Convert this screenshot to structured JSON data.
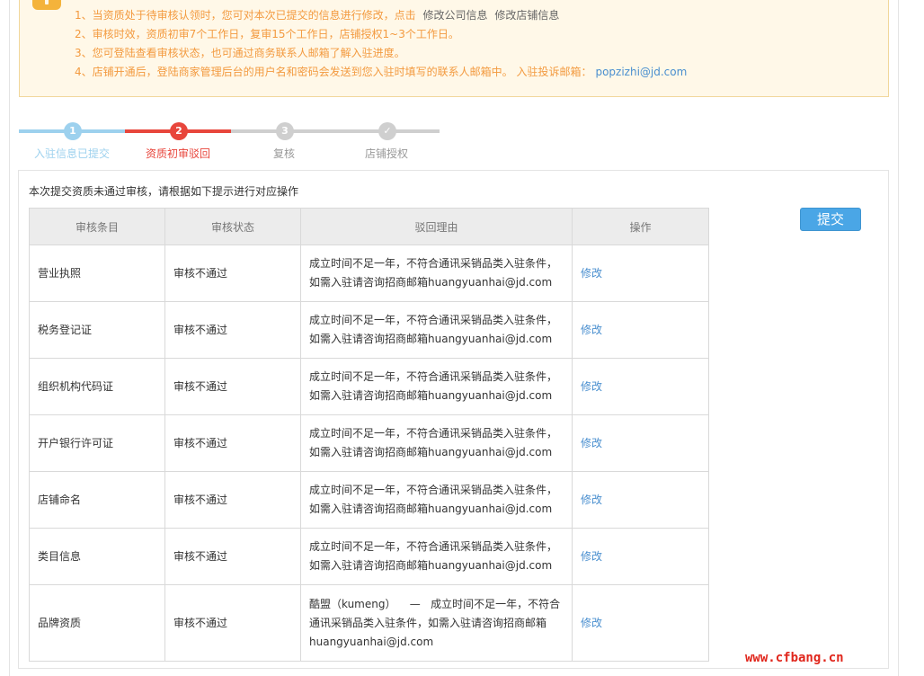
{
  "notice": {
    "items": [
      {
        "text": "1、当资质处于待审核认领时，您可对本次已提交的信息进行修改，点击",
        "link1": "修改公司信息",
        "link2": "修改店铺信息"
      },
      {
        "text": "2、审核时效，资质初审7个工作日，复审15个工作日，店铺授权1~3个工作日。"
      },
      {
        "text": "3、您可登陆查看审核状态，也可通过商务联系人邮箱了解入驻进度。"
      },
      {
        "text": "4、店铺开通后，登陆商家管理后台的用户名和密码会发送到您入驻时填写的联系人邮箱中。 入驻投诉邮箱：",
        "email": "popzizhi@jd.com"
      }
    ]
  },
  "steps": [
    {
      "num": "1",
      "label": "入驻信息已提交",
      "state": "done"
    },
    {
      "num": "2",
      "label": "资质初审驳回",
      "state": "active"
    },
    {
      "num": "3",
      "label": "复核",
      "state": "pending"
    },
    {
      "num": "✓",
      "label": "店铺授权",
      "state": "pending"
    }
  ],
  "intro": "本次提交资质未通过审核，请根据如下提示进行对应操作",
  "submit_label": "提交",
  "table": {
    "headers": [
      "审核条目",
      "审核状态",
      "驳回理由",
      "操作"
    ],
    "rows": [
      {
        "item": "营业执照",
        "status": "审核不通过",
        "reason1": "成立时间不足一年，不符合通讯采销品类入驻条件，",
        "reason2": "如需入驻请咨询招商邮箱huangyuanhai@jd.com",
        "action": "修改"
      },
      {
        "item": "税务登记证",
        "status": "审核不通过",
        "reason1": "成立时间不足一年，不符合通讯采销品类入驻条件，",
        "reason2": "如需入驻请咨询招商邮箱huangyuanhai@jd.com",
        "action": "修改"
      },
      {
        "item": "组织机构代码证",
        "status": "审核不通过",
        "reason1": "成立时间不足一年，不符合通讯采销品类入驻条件，",
        "reason2": "如需入驻请咨询招商邮箱huangyuanhai@jd.com",
        "action": "修改"
      },
      {
        "item": "开户银行许可证",
        "status": "审核不通过",
        "reason1": "成立时间不足一年，不符合通讯采销品类入驻条件，",
        "reason2": "如需入驻请咨询招商邮箱huangyuanhai@jd.com",
        "action": "修改"
      },
      {
        "item": "店铺命名",
        "status": "审核不通过",
        "reason1": "成立时间不足一年，不符合通讯采销品类入驻条件，",
        "reason2": "如需入驻请咨询招商邮箱huangyuanhai@jd.com",
        "action": "修改"
      },
      {
        "item": "类目信息",
        "status": "审核不通过",
        "reason1": "成立时间不足一年，不符合通讯采销品类入驻条件，",
        "reason2": "如需入驻请咨询招商邮箱huangyuanhai@jd.com",
        "action": "修改"
      },
      {
        "item": "品牌资质",
        "status": "审核不通过",
        "reason1": "酷盟（kumeng）    —   成立时间不足一年，不符合",
        "reason2": "通讯采销品类入驻条件，如需入驻请咨询招商邮箱",
        "reason3": "huangyuanhai@jd.com",
        "action": "修改"
      }
    ]
  },
  "watermark": "www.cfbang.cn"
}
